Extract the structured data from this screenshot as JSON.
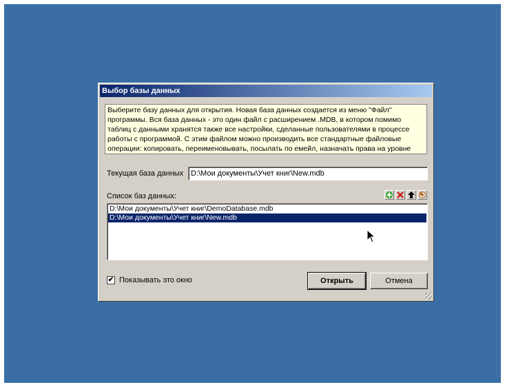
{
  "dialog": {
    "title": "Выбор базы данных",
    "info_lines": [
      "Выберите базу данных для открытия. Новая база данных создается из меню \"Файл\"",
      "программы. Вся база данных - это один файл с расширением .MDB, в котором помимо",
      "таблиц с данными хранятся также все настройки, сделанные пользователями в процессе",
      "работы с программой. С этим файлом можно производить все стандартные файловые",
      "операции: копировать, переименовывать, посылать по емейл, назначать права на уровне"
    ],
    "current_db_label": "Текущая база данных",
    "current_db_value": "D:\\Мои документы\\Учет книг\\New.mdb",
    "list_label": "Список баз данных:",
    "toolbar": {
      "add_icon": "add-icon",
      "delete_icon": "delete-icon",
      "up_icon": "arrow-up-icon",
      "refresh_icon": "refresh-icon"
    },
    "databases": [
      {
        "path": "D:\\Мои документы\\Учет книг\\DemoDatabase.mdb",
        "selected": false
      },
      {
        "path": "D:\\Мои документы\\Учет книг\\New.mdb",
        "selected": true
      }
    ],
    "show_window_label": "Показывать это окно",
    "show_window_checked": true,
    "open_button": "Открыть",
    "cancel_button": "Отмена"
  },
  "colors": {
    "desktop": "#3a6ea5",
    "window": "#d4d0c8",
    "title_start": "#0a246a",
    "title_end": "#a6caf0",
    "info_bg": "#ffffe1",
    "selection": "#0a246a"
  }
}
